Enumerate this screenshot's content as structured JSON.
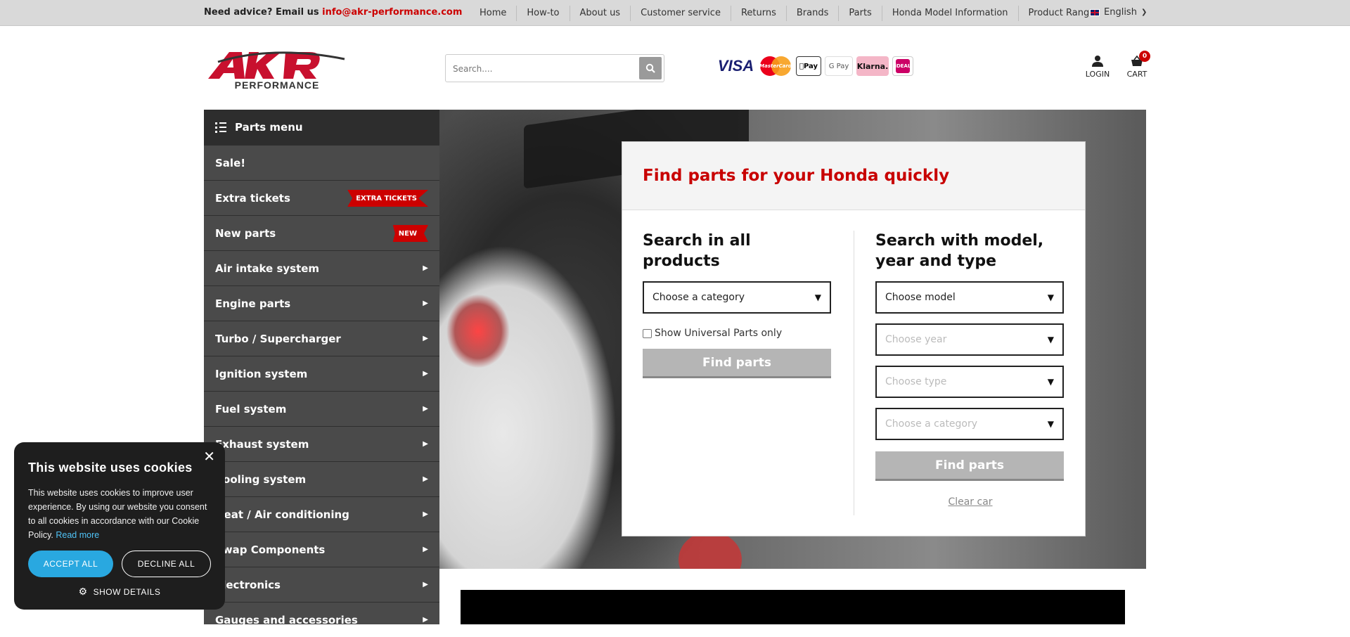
{
  "topbar": {
    "advice_prefix": "Need advice? Email us ",
    "advice_email": "info@akr-performance.com",
    "nav": [
      "Home",
      "How-to",
      "About us",
      "Customer service",
      "Returns",
      "Brands",
      "Parts",
      "Honda Model Information",
      "Product Range"
    ],
    "language": "English"
  },
  "header": {
    "logo_top": "AKR",
    "logo_bottom": "PERFORMANCE",
    "search_placeholder": "Search....",
    "payments": {
      "visa": "VISA",
      "mastercard": "MasterCard",
      "applepay": "Pay",
      "googlepay": "G Pay",
      "klarna": "Klarna.",
      "ideal": "iDEAL"
    },
    "login_label": "LOGIN",
    "cart_label": "CART",
    "cart_count": "0"
  },
  "sidebar": {
    "title": "Parts menu",
    "items": [
      {
        "label": "Sale!"
      },
      {
        "label": "Extra tickets",
        "ribbon": "EXTRA TICKETS"
      },
      {
        "label": "New parts",
        "ribbon": "NEW"
      },
      {
        "label": "Air intake system"
      },
      {
        "label": "Engine parts"
      },
      {
        "label": "Turbo / Supercharger"
      },
      {
        "label": "Ignition system"
      },
      {
        "label": "Fuel system"
      },
      {
        "label": "Exhaust system"
      },
      {
        "label": "Cooling system"
      },
      {
        "label": "Heat / Air conditioning"
      },
      {
        "label": "Swap Components"
      },
      {
        "label": "Electronics"
      },
      {
        "label": "Gauges and accessories"
      }
    ]
  },
  "finder": {
    "title": "Find parts for your Honda quickly",
    "left_title": "Search in all products",
    "category_select": "Choose a category",
    "universal_label": "Show Universal Parts only",
    "find_button": "Find parts",
    "right_title": "Search with model, year and type",
    "model_select": "Choose model",
    "year_select": "Choose year",
    "type_select": "Choose type",
    "category_select_right": "Choose a category",
    "find_button_right": "Find parts",
    "clear_car": "Clear car"
  },
  "cookie": {
    "title": "This website uses cookies",
    "text": "This website uses cookies to improve user experience. By using our website you consent to all cookies in accordance with our Cookie Policy.",
    "read_more": "Read more",
    "accept": "ACCEPT ALL",
    "decline": "DECLINE ALL",
    "details": "SHOW DETAILS"
  },
  "colors": {
    "brand_red": "#cc0000",
    "sidebar_bg": "#4a4a4a",
    "accept_blue": "#29a8e0"
  }
}
